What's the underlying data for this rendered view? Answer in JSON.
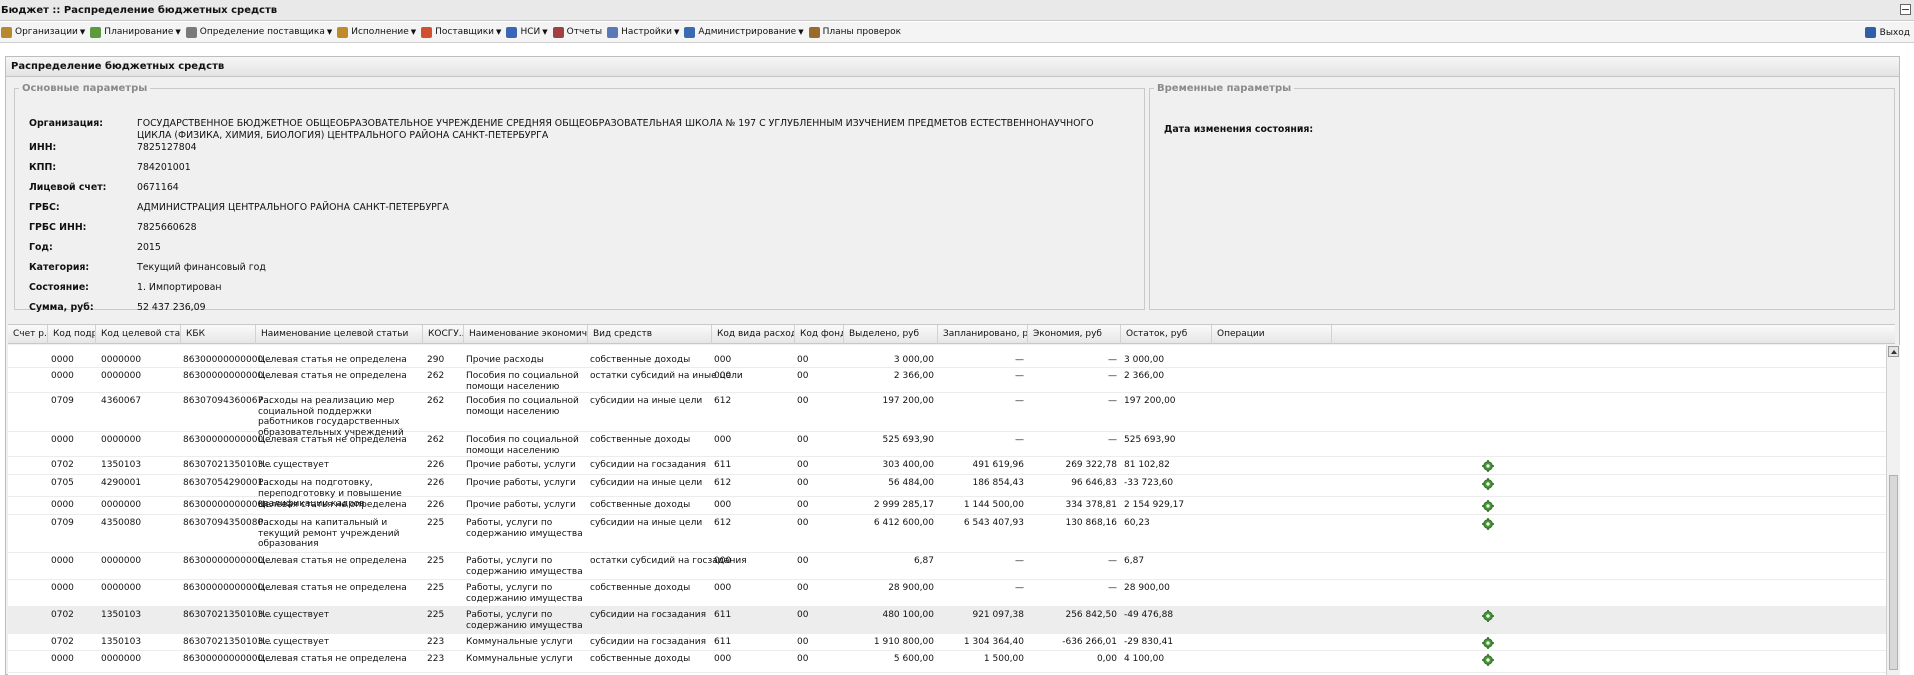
{
  "window": {
    "title": "Бюджет :: Распределение бюджетных средств"
  },
  "menu": [
    {
      "label": "Организации",
      "icon": "org-icon",
      "color": "#b7882c",
      "caret": true
    },
    {
      "label": "Планирование",
      "icon": "planning-icon",
      "color": "#5a9b3d",
      "caret": true
    },
    {
      "label": "Определение поставщика",
      "icon": "gear-icon",
      "color": "#7a7a7a",
      "caret": true
    },
    {
      "label": "Исполнение",
      "icon": "execution-icon",
      "color": "#c08a2a",
      "caret": true
    },
    {
      "label": "Поставщики",
      "icon": "suppliers-icon",
      "color": "#d05030",
      "caret": true
    },
    {
      "label": "НСИ",
      "icon": "nsi-icon",
      "color": "#3a67b5",
      "caret": true
    },
    {
      "label": "Отчеты",
      "icon": "reports-icon",
      "color": "#a04040",
      "caret": false
    },
    {
      "label": "Настройки",
      "icon": "tools-icon",
      "color": "#5a78b8",
      "caret": true
    },
    {
      "label": "Администрирование",
      "icon": "admin-icon",
      "color": "#3a6ab0",
      "caret": true
    },
    {
      "label": "Планы проверок",
      "icon": "inspection-icon",
      "color": "#9a6a2a",
      "caret": false
    }
  ],
  "exit_label": "Выход",
  "panel": {
    "title": "Распределение бюджетных средств"
  },
  "params": {
    "legend": "Основные параметры",
    "rows": [
      {
        "label": "Организация:",
        "value": "ГОСУДАРСТВЕННОЕ БЮДЖЕТНОЕ ОБЩЕОБРАЗОВАТЕЛЬНОЕ УЧРЕЖДЕНИЕ СРЕДНЯЯ ОБЩЕОБРАЗОВАТЕЛЬНАЯ ШКОЛА № 197 С УГЛУБЛЕННЫМ ИЗУЧЕНИЕМ ПРЕДМЕТОВ ЕСТЕСТВЕННОНАУЧНОГО ЦИКЛА (ФИЗИКА, ХИМИЯ, БИОЛОГИЯ) ЦЕНТРАЛЬНОГО РАЙОНА САНКТ-ПЕТЕРБУРГА"
      },
      {
        "label": "ИНН:",
        "value": "7825127804"
      },
      {
        "label": "КПП:",
        "value": "784201001"
      },
      {
        "label": "Лицевой счет:",
        "value": "0671164"
      },
      {
        "label": "ГРБС:",
        "value": "АДМИНИСТРАЦИЯ ЦЕНТРАЛЬНОГО РАЙОНА САНКТ-ПЕТЕРБУРГА"
      },
      {
        "label": "ГРБС ИНН:",
        "value": "7825660628"
      },
      {
        "label": "Год:",
        "value": "2015"
      },
      {
        "label": "Категория:",
        "value": "Текущий финансовый год"
      },
      {
        "label": "Состояние:",
        "value": "1. Импортирован"
      },
      {
        "label": "Сумма, руб:",
        "value": "52 437 236,09"
      }
    ]
  },
  "temp": {
    "legend": "Временные параметры",
    "label": "Дата изменения состояния:",
    "value": "-"
  },
  "grid": {
    "columns": [
      "Счет р...",
      "Код подра...",
      "Код целевой статьи",
      "КБК",
      "Наименование целевой статьи",
      "КОСГУ...",
      "Наименование экономической ...",
      "Вид средств",
      "Код вида расходов",
      "Код фонда",
      "Выделено, руб",
      "Запланировано, руб",
      "Экономия, руб",
      "Остаток, руб",
      "Операции"
    ],
    "rows": [
      {
        "podr": "0000",
        "cel": "0000000",
        "kbk": "86300000000000...",
        "name": "Целевая статья не определена",
        "kosgu": "290",
        "econ": "Прочие расходы",
        "vid": "собственные доходы",
        "kvr": "000",
        "fond": "00",
        "vyd": "3 000,00",
        "plan": "—",
        "econom": "—",
        "ost": "3 000,00",
        "op": false
      },
      {
        "podr": "0000",
        "cel": "0000000",
        "kbk": "86300000000000...",
        "name": "Целевая статья не определена",
        "kosgu": "262",
        "econ": "Пособия по социальной помощи населению",
        "vid": "остатки субсидий на иные цели",
        "kvr": "000",
        "fond": "00",
        "vyd": "2 366,00",
        "plan": "—",
        "econom": "—",
        "ost": "2 366,00",
        "op": false
      },
      {
        "podr": "0709",
        "cel": "4360067",
        "kbk": "86307094360067...",
        "name": "Расходы на реализацию мер социальной поддержки работников государственных образовательных учреждений",
        "kosgu": "262",
        "econ": "Пособия по социальной помощи населению",
        "vid": "субсидии на иные цели",
        "kvr": "612",
        "fond": "00",
        "vyd": "197 200,00",
        "plan": "—",
        "econom": "—",
        "ost": "197 200,00",
        "op": false
      },
      {
        "podr": "0000",
        "cel": "0000000",
        "kbk": "86300000000000...",
        "name": "Целевая статья не определена",
        "kosgu": "262",
        "econ": "Пособия по социальной помощи населению",
        "vid": "собственные доходы",
        "kvr": "000",
        "fond": "00",
        "vyd": "525 693,90",
        "plan": "—",
        "econom": "—",
        "ost": "525 693,90",
        "op": false
      },
      {
        "podr": "0702",
        "cel": "1350103",
        "kbk": "86307021350103...",
        "name": "Не существует",
        "kosgu": "226",
        "econ": "Прочие работы, услуги",
        "vid": "субсидии на госзадания",
        "kvr": "611",
        "fond": "00",
        "vyd": "303 400,00",
        "plan": "491 619,96",
        "econom": "269 322,78",
        "ost": "81 102,82",
        "op": true
      },
      {
        "podr": "0705",
        "cel": "4290001",
        "kbk": "86307054290001...",
        "name": "Расходы на подготовку, переподготовку и повышение квалификации кадров",
        "kosgu": "226",
        "econ": "Прочие работы, услуги",
        "vid": "субсидии на иные цели",
        "kvr": "612",
        "fond": "00",
        "vyd": "56 484,00",
        "plan": "186 854,43",
        "econom": "96 646,83",
        "ost": "-33 723,60",
        "op": true
      },
      {
        "podr": "0000",
        "cel": "0000000",
        "kbk": "86300000000000...",
        "name": "Целевая статья не определена",
        "kosgu": "226",
        "econ": "Прочие работы, услуги",
        "vid": "собственные доходы",
        "kvr": "000",
        "fond": "00",
        "vyd": "2 999 285,17",
        "plan": "1 144 500,00",
        "econom": "334 378,81",
        "ost": "2 154 929,17",
        "op": true
      },
      {
        "podr": "0709",
        "cel": "4350080",
        "kbk": "86307094350080...",
        "name": "Расходы на капитальный и текущий ремонт учреждений образования",
        "kosgu": "225",
        "econ": "Работы, услуги по содержанию имущества",
        "vid": "субсидии на иные цели",
        "kvr": "612",
        "fond": "00",
        "vyd": "6 412 600,00",
        "plan": "6 543 407,93",
        "econom": "130 868,16",
        "ost": "60,23",
        "op": true
      },
      {
        "podr": "0000",
        "cel": "0000000",
        "kbk": "86300000000000...",
        "name": "Целевая статья не определена",
        "kosgu": "225",
        "econ": "Работы, услуги по содержанию имущества",
        "vid": "остатки субсидий на госзадания",
        "kvr": "000",
        "fond": "00",
        "vyd": "6,87",
        "plan": "—",
        "econom": "—",
        "ost": "6,87",
        "op": false
      },
      {
        "podr": "0000",
        "cel": "0000000",
        "kbk": "86300000000000...",
        "name": "Целевая статья не определена",
        "kosgu": "225",
        "econ": "Работы, услуги по содержанию имущества",
        "vid": "собственные доходы",
        "kvr": "000",
        "fond": "00",
        "vyd": "28 900,00",
        "plan": "—",
        "econom": "—",
        "ost": "28 900,00",
        "op": false
      },
      {
        "podr": "0702",
        "cel": "1350103",
        "kbk": "86307021350103...",
        "name": "Не существует",
        "kosgu": "225",
        "econ": "Работы, услуги по содержанию имущества",
        "vid": "субсидии на госзадания",
        "kvr": "611",
        "fond": "00",
        "vyd": "480 100,00",
        "plan": "921 097,38",
        "econom": "256 842,50",
        "ost": "-49 476,88",
        "op": true
      },
      {
        "podr": "0702",
        "cel": "1350103",
        "kbk": "86307021350103...",
        "name": "Не существует",
        "kosgu": "223",
        "econ": "Коммунальные услуги",
        "vid": "субсидии на госзадания",
        "kvr": "611",
        "fond": "00",
        "vyd": "1 910 800,00",
        "plan": "1 304 364,40",
        "econom": "-636 266,01",
        "ost": "-29 830,41",
        "op": true
      },
      {
        "podr": "0000",
        "cel": "0000000",
        "kbk": "86300000000000...",
        "name": "Целевая статья не определена",
        "kosgu": "223",
        "econ": "Коммунальные услуги",
        "vid": "собственные доходы",
        "kvr": "000",
        "fond": "00",
        "vyd": "5 600,00",
        "plan": "1 500,00",
        "econom": "0,00",
        "ost": "4 100,00",
        "op": true
      }
    ]
  }
}
